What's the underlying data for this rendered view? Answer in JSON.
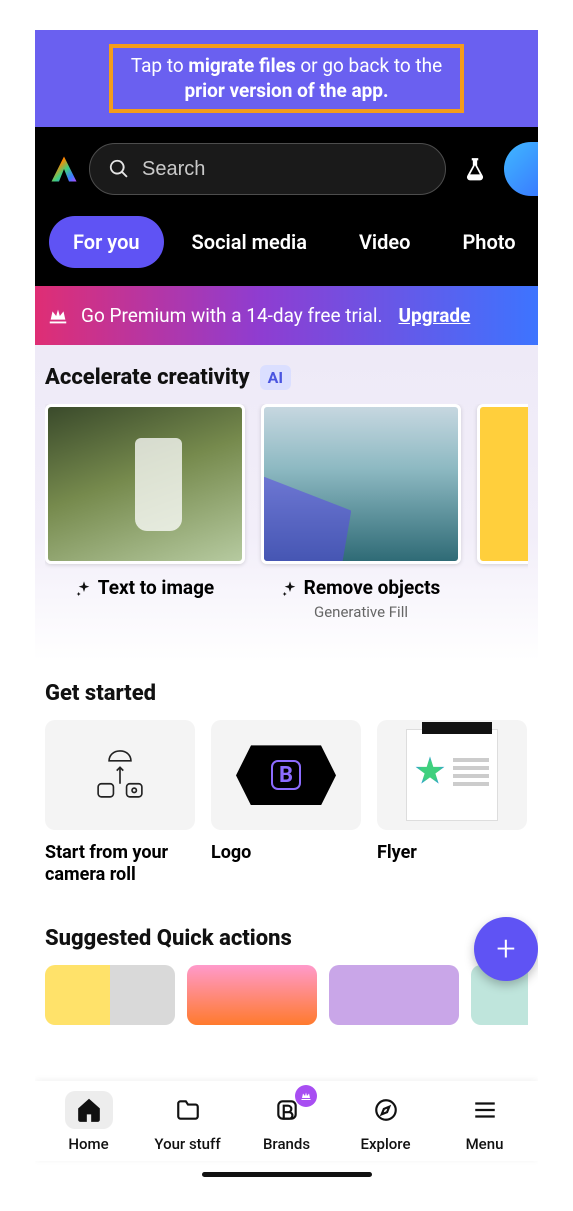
{
  "banner": {
    "pre": "Tap to ",
    "bold1": "migrate files",
    "mid": " or go back to the ",
    "bold2": "prior version of the app."
  },
  "search": {
    "placeholder": "Search"
  },
  "tabs": [
    "For you",
    "Social media",
    "Video",
    "Photo"
  ],
  "premium": {
    "text": "Go Premium with a 14-day free trial.",
    "cta": "Upgrade"
  },
  "accelerate": {
    "title": "Accelerate creativity",
    "badge": "AI",
    "cards": [
      {
        "label": "Text to image",
        "sub": ""
      },
      {
        "label": "Remove objects",
        "sub": "Generative Fill"
      },
      {
        "label": "",
        "sub": ""
      }
    ]
  },
  "getStarted": {
    "title": "Get started",
    "cards": [
      {
        "label": "Start from your camera roll"
      },
      {
        "label": "Logo"
      },
      {
        "label": "Flyer"
      }
    ]
  },
  "suggested": {
    "title": "Suggested Quick actions"
  },
  "nav": {
    "items": [
      "Home",
      "Your stuff",
      "Brands",
      "Explore",
      "Menu"
    ]
  },
  "fab": "+"
}
